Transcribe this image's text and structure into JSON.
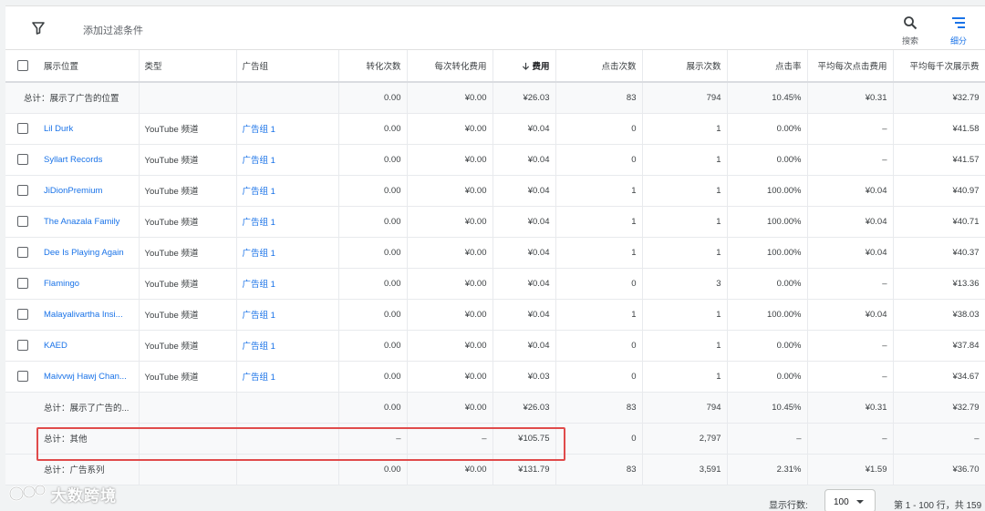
{
  "toolbar": {
    "filter_label": "添加过滤条件",
    "search_label": "搜索",
    "segment_label": "细分"
  },
  "columns": {
    "placement": "展示位置",
    "type": "类型",
    "ad_group": "广告组",
    "conversions": "转化次数",
    "cost_per_conv": "每次转化费用",
    "cost": "费用",
    "clicks": "点击次数",
    "impressions": "展示次数",
    "ctr": "点击率",
    "avg_cpc": "平均每次点击费用",
    "avg_cpm": "平均每千次展示费"
  },
  "top_total": {
    "label": "总计：展示了广告的位置",
    "conversions": "0.00",
    "cost_per_conv": "¥0.00",
    "cost": "¥26.03",
    "clicks": "83",
    "impressions": "794",
    "ctr": "10.45%",
    "avg_cpc": "¥0.31",
    "avg_cpm": "¥32.79"
  },
  "rows": [
    {
      "placement": "Lil Durk",
      "type": "YouTube 频道",
      "ad_group": "广告组 1",
      "conversions": "0.00",
      "cost_per_conv": "¥0.00",
      "cost": "¥0.04",
      "clicks": "0",
      "impressions": "1",
      "ctr": "0.00%",
      "avg_cpc": "–",
      "avg_cpm": "¥41.58"
    },
    {
      "placement": "Syllart Records",
      "type": "YouTube 频道",
      "ad_group": "广告组 1",
      "conversions": "0.00",
      "cost_per_conv": "¥0.00",
      "cost": "¥0.04",
      "clicks": "0",
      "impressions": "1",
      "ctr": "0.00%",
      "avg_cpc": "–",
      "avg_cpm": "¥41.57"
    },
    {
      "placement": "JiDionPremium",
      "type": "YouTube 频道",
      "ad_group": "广告组 1",
      "conversions": "0.00",
      "cost_per_conv": "¥0.00",
      "cost": "¥0.04",
      "clicks": "1",
      "impressions": "1",
      "ctr": "100.00%",
      "avg_cpc": "¥0.04",
      "avg_cpm": "¥40.97"
    },
    {
      "placement": "The Anazala Family",
      "type": "YouTube 频道",
      "ad_group": "广告组 1",
      "conversions": "0.00",
      "cost_per_conv": "¥0.00",
      "cost": "¥0.04",
      "clicks": "1",
      "impressions": "1",
      "ctr": "100.00%",
      "avg_cpc": "¥0.04",
      "avg_cpm": "¥40.71"
    },
    {
      "placement": "Dee Is Playing Again",
      "type": "YouTube 频道",
      "ad_group": "广告组 1",
      "conversions": "0.00",
      "cost_per_conv": "¥0.00",
      "cost": "¥0.04",
      "clicks": "1",
      "impressions": "1",
      "ctr": "100.00%",
      "avg_cpc": "¥0.04",
      "avg_cpm": "¥40.37"
    },
    {
      "placement": "Flamingo",
      "type": "YouTube 频道",
      "ad_group": "广告组 1",
      "conversions": "0.00",
      "cost_per_conv": "¥0.00",
      "cost": "¥0.04",
      "clicks": "0",
      "impressions": "3",
      "ctr": "0.00%",
      "avg_cpc": "–",
      "avg_cpm": "¥13.36"
    },
    {
      "placement": "Malayalivartha Insi...",
      "type": "YouTube 频道",
      "ad_group": "广告组 1",
      "conversions": "0.00",
      "cost_per_conv": "¥0.00",
      "cost": "¥0.04",
      "clicks": "1",
      "impressions": "1",
      "ctr": "100.00%",
      "avg_cpc": "¥0.04",
      "avg_cpm": "¥38.03"
    },
    {
      "placement": "KAED",
      "type": "YouTube 频道",
      "ad_group": "广告组 1",
      "conversions": "0.00",
      "cost_per_conv": "¥0.00",
      "cost": "¥0.04",
      "clicks": "0",
      "impressions": "1",
      "ctr": "0.00%",
      "avg_cpc": "–",
      "avg_cpm": "¥37.84"
    },
    {
      "placement": "Maivvwj Hawj Chan...",
      "type": "YouTube 频道",
      "ad_group": "广告组 1",
      "conversions": "0.00",
      "cost_per_conv": "¥0.00",
      "cost": "¥0.03",
      "clicks": "0",
      "impressions": "1",
      "ctr": "0.00%",
      "avg_cpc": "–",
      "avg_cpm": "¥34.67"
    }
  ],
  "bottom_totals": [
    {
      "label": "总计：展示了广告的...",
      "conversions": "0.00",
      "cost_per_conv": "¥0.00",
      "cost": "¥26.03",
      "clicks": "83",
      "impressions": "794",
      "ctr": "10.45%",
      "avg_cpc": "¥0.31",
      "avg_cpm": "¥32.79"
    },
    {
      "label": "总计：其他",
      "conversions": "–",
      "cost_per_conv": "–",
      "cost": "¥105.75",
      "clicks": "0",
      "impressions": "2,797",
      "ctr": "–",
      "avg_cpc": "–",
      "avg_cpm": "–"
    },
    {
      "label": "总计：广告系列",
      "conversions": "0.00",
      "cost_per_conv": "¥0.00",
      "cost": "¥131.79",
      "clicks": "83",
      "impressions": "3,591",
      "ctr": "2.31%",
      "avg_cpc": "¥1.59",
      "avg_cpm": "¥36.70"
    }
  ],
  "footer": {
    "rows_label": "显示行数:",
    "rows_value": "100",
    "page_info": "第 1 - 100 行，共 159"
  },
  "watermark": {
    "text": "大数跨境"
  },
  "colors": {
    "link": "#1a73e8",
    "highlight": "#e04b4b"
  },
  "icons": {
    "filter": "filter-icon",
    "search": "search-icon",
    "segment": "segment-icon",
    "sort": "arrow-down-icon"
  }
}
